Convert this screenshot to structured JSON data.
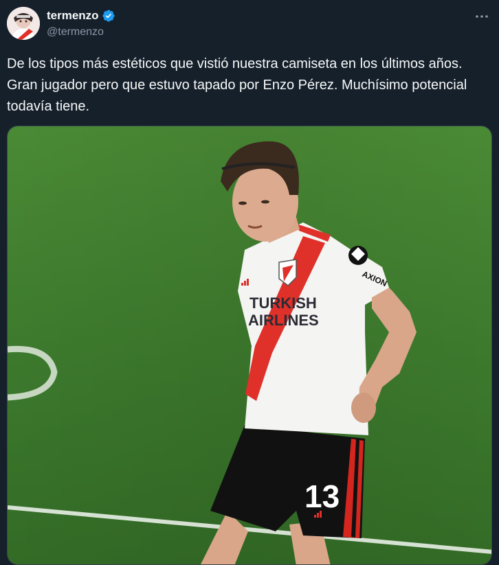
{
  "tweet": {
    "display_name": "termenzo",
    "handle": "@termenzo",
    "verified": true,
    "verified_color": "#1d9bf0",
    "more_icon": "more-horizontal-icon",
    "text": "De los tipos más estéticos que vistió nuestra camiseta en los últimos años. Gran jugador pero que estuvo tapado por Enzo Pérez. Muchísimo potencial todavía tiene.",
    "media": {
      "shirt_sponsor_line1": "TURKISH",
      "shirt_sponsor_line2": "AIRLINES",
      "sleeve_sponsor": "AXION",
      "shorts_number": "13"
    }
  },
  "colors": {
    "background": "#15202b",
    "text_primary": "#f7f9f9",
    "text_secondary": "#8b98a5",
    "pitch": "#3f7a2e",
    "river_red": "#e0302a"
  }
}
